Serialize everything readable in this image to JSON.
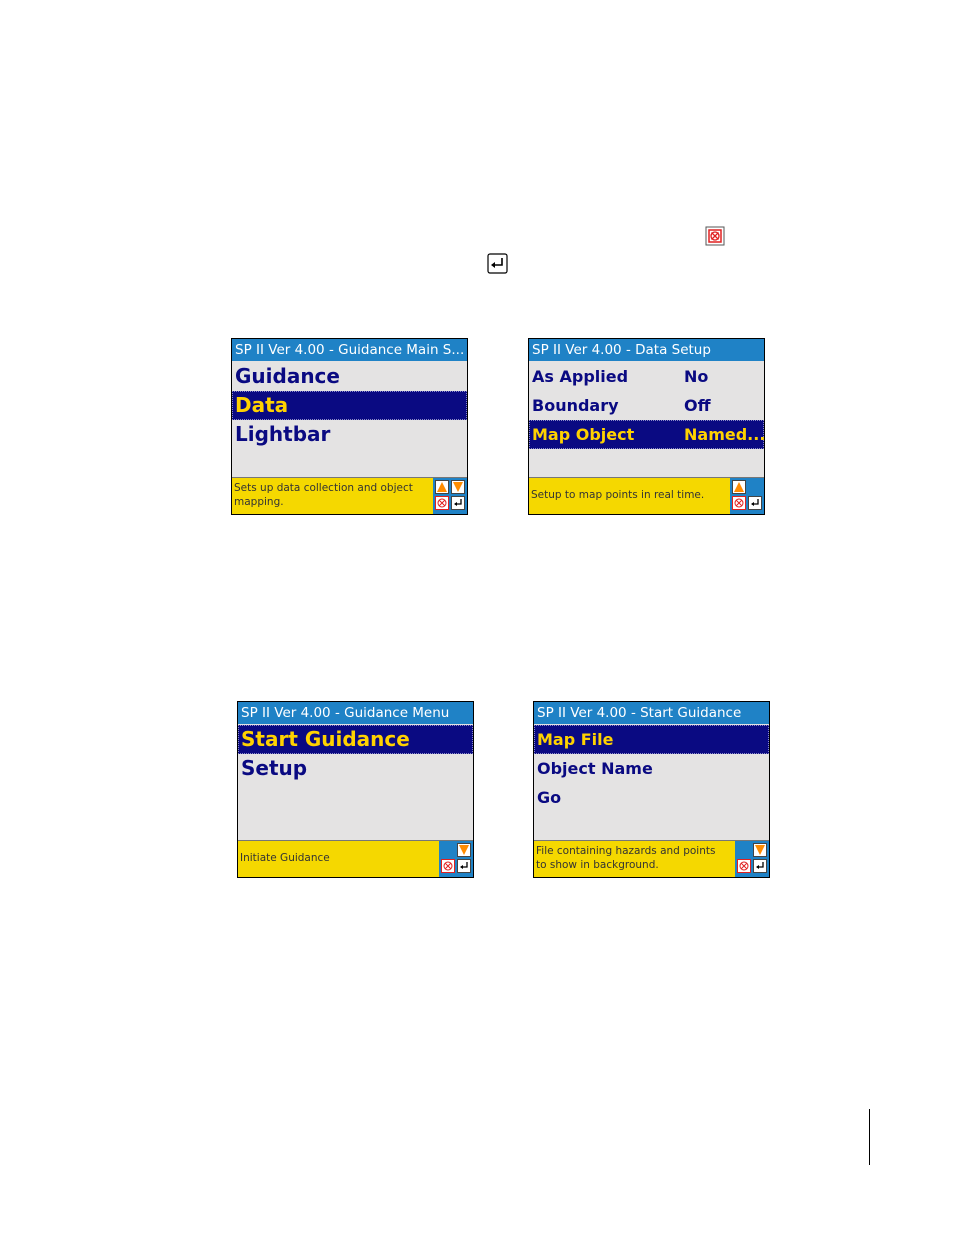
{
  "screens": [
    {
      "title": "SP II Ver 4.00 - Guidance Main S...",
      "items": [
        {
          "label": "Guidance",
          "value": ""
        },
        {
          "label": "Data",
          "value": ""
        },
        {
          "label": "Lightbar",
          "value": ""
        }
      ],
      "selected_index": 1,
      "status": "Sets up data collection and object mapping."
    },
    {
      "title": "SP II Ver 4.00 - Data Setup",
      "items": [
        {
          "label": "As Applied",
          "value": "No"
        },
        {
          "label": "Boundary",
          "value": "Off"
        },
        {
          "label": "Map Object",
          "value": "Named..."
        }
      ],
      "selected_index": 2,
      "status": "Setup to map points in real time."
    },
    {
      "title": "SP II Ver 4.00 - Guidance Menu",
      "items": [
        {
          "label": "Start Guidance",
          "value": ""
        },
        {
          "label": "Setup",
          "value": ""
        }
      ],
      "selected_index": 0,
      "status": "Initiate Guidance"
    },
    {
      "title": "SP II Ver 4.00 - Start Guidance",
      "items": [
        {
          "label": "Map File",
          "value": ""
        },
        {
          "label": "Object Name",
          "value": ""
        },
        {
          "label": "Go",
          "value": ""
        }
      ],
      "selected_index": 0,
      "status": "File containing hazards and points to show in background."
    }
  ],
  "icons": {
    "inline_escape": "escape-icon",
    "inline_enter": "enter-icon",
    "nav_up": "up-arrow-icon",
    "nav_down": "down-arrow-icon",
    "nav_escape": "escape-icon",
    "nav_enter": "enter-icon"
  },
  "colors": {
    "title_bar": "#1f82c6",
    "body": "#e4e3e3",
    "item_text": "#0a0a82",
    "selected_bg": "#0a0a82",
    "selected_text": "#ffd200",
    "status_bg": "#f5d800",
    "arrow": "#ff8c00",
    "escape": "#e02020"
  }
}
